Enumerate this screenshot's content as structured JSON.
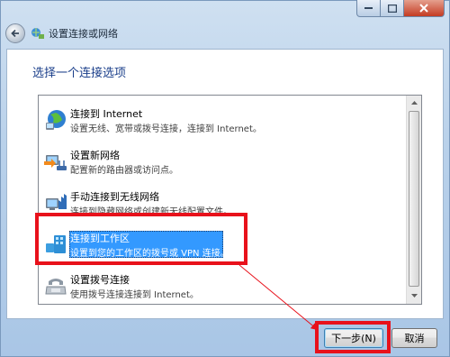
{
  "window": {
    "title": "设置连接或网络",
    "heading": "选择一个连接选项"
  },
  "items": [
    {
      "title": "连接到 Internet",
      "desc": "设置无线、宽带或拨号连接，连接到 Internet。",
      "icon": "globe-network-icon"
    },
    {
      "title": "设置新网络",
      "desc": "配置新的路由器或访问点。",
      "icon": "router-setup-icon"
    },
    {
      "title": "手动连接到无线网络",
      "desc": "连接到隐藏网络或创建新无线配置文件。",
      "icon": "wireless-computer-icon"
    },
    {
      "title": "连接到工作区",
      "desc": "设置到您的工作区的拨号或 VPN 连接。",
      "icon": "workplace-vpn-icon",
      "selected": true
    },
    {
      "title": "设置拨号连接",
      "desc": "使用拨号连接连接到 Internet。",
      "icon": "dialup-phone-icon"
    }
  ],
  "buttons": {
    "next": "下一步(N)",
    "cancel": "取消"
  },
  "colors": {
    "highlight": "#e8111b",
    "selection": "#3399ff",
    "heading": "#1a3e8a"
  }
}
